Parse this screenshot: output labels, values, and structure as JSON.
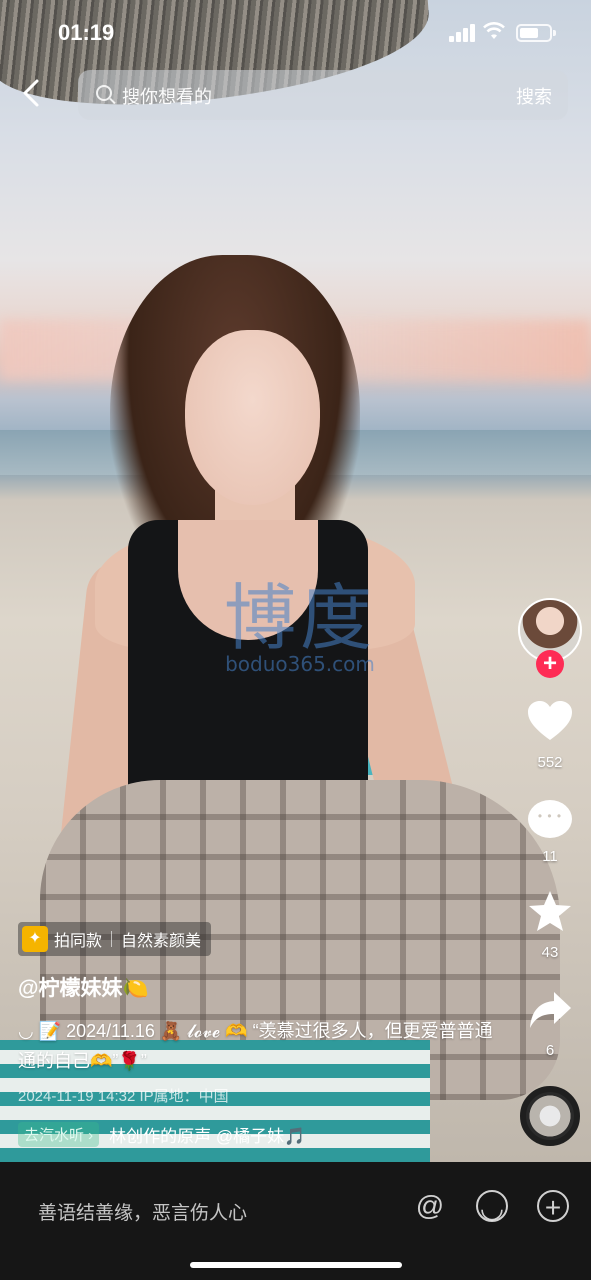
{
  "status_bar": {
    "time": "01:19",
    "battery_level": 0.65
  },
  "search": {
    "placeholder": "搜你想看的",
    "submit_label": "搜索"
  },
  "watermark": {
    "text_cn": "博度",
    "text_url": "boduo365.com"
  },
  "actions": {
    "likes": "552",
    "comments": "11",
    "favorites": "43",
    "shares": "6",
    "follow_symbol": "+"
  },
  "caption": {
    "tag_1": "拍同款",
    "tag_2": "自然素颜美",
    "author": "@柠檬妹妹🍋",
    "text": "◡ 📝 2024/11.16 🧸 𝓵𝓸𝓿𝓮 🫶 “羡慕过很多人，但更爱普普通通的自己🫶”🌹”",
    "meta": "2024-11-19 14:32  IP属地：中国",
    "qishui_label": "去汽水听 ›",
    "music": "林创作的原声    @橘子妹🎵"
  },
  "bottom_bar": {
    "placeholder": "善语结善缘，恶言伤人心"
  },
  "icons": {
    "back": "chevron-left-icon",
    "search": "search-icon",
    "like": "heart-icon",
    "comment": "comment-icon",
    "favorite": "star-icon",
    "share": "share-icon",
    "at": "at-icon",
    "emoji": "emoji-icon",
    "add": "plus-icon"
  },
  "colors": {
    "follow": "#fe2c55",
    "bottom_bar": "#161616"
  }
}
